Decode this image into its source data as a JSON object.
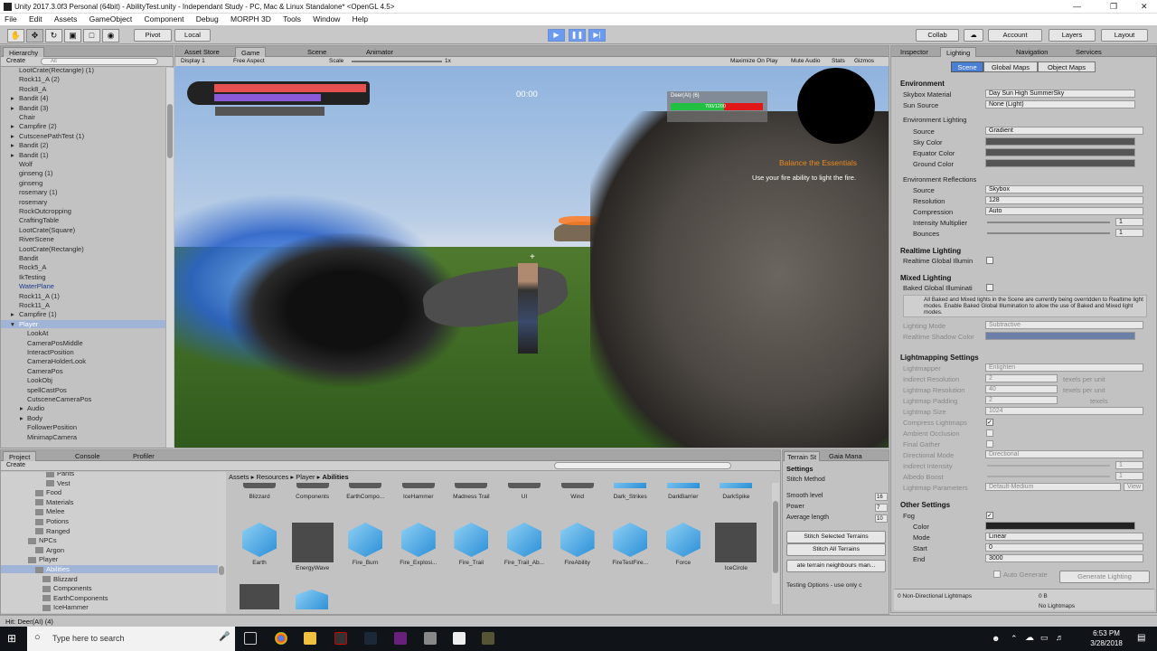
{
  "window": {
    "title": "Unity 2017.3.0f3 Personal (64bit) - AbilityTest.unity - Independant Study - PC, Mac & Linux Standalone* <OpenGL 4.5>"
  },
  "menu": [
    "File",
    "Edit",
    "Assets",
    "GameObject",
    "Component",
    "Debug",
    "MORPH 3D",
    "Tools",
    "Window",
    "Help"
  ],
  "toolbar": {
    "pivot": "Pivot",
    "local": "Local",
    "collab": "Collab",
    "account": "Account",
    "layers": "Layers",
    "layout": "Layout"
  },
  "hierarchy": {
    "tab": "Hierarchy",
    "create": "Create",
    "search_placeholder": "All",
    "items": [
      "LootCrate(Rectangle) (1)",
      "Rock11_A (2)",
      "Rock8_A",
      "Bandit (4)",
      "Bandit (3)",
      "Chair",
      "Campfire (2)",
      "CutscenePathTest (1)",
      "Bandit (2)",
      "Bandit (1)",
      "Wolf",
      "ginseng (1)",
      "ginseng",
      "rosemary (1)",
      "rosemary",
      "RockOutcropping",
      "CraftingTable",
      "LootCrate(Square)",
      "RiverScene",
      "LootCrate(Rectangle)",
      "Bandit",
      "Rock5_A",
      "IkTesting",
      "WaterPlane",
      "Rock11_A (1)",
      "Rock11_A",
      "Campfire (1)",
      "Player",
      "LookAt",
      "CameraPosMiddle",
      "InteractPosition",
      "CameraHolderLook",
      "CameraPos",
      "LookObj",
      "spellCastPos",
      "CutsceneCameraPos",
      "Audio",
      "Body",
      "FollowerPosition",
      "MinimapCamera"
    ]
  },
  "game_tabs": {
    "asset_store": "Asset Store",
    "game": "Game",
    "scene": "Scene",
    "animator": "Animator"
  },
  "game_bar": {
    "display": "Display 1",
    "aspect": "Free Aspect",
    "scale_label": "Scale",
    "scale_value": "1x",
    "maximize": "Maximize On Play",
    "mute": "Mute Audio",
    "stats": "Stats",
    "gizmos": "Gizmos"
  },
  "game_hud": {
    "timer": "00:00",
    "enemy_name": "Deer(AI) (6)",
    "enemy_hp": "700/1200",
    "enemy_hp_fraction": 0.58,
    "quest_title": "Balance the Essentials",
    "quest_text": "Use your fire ability to light the fire."
  },
  "inspector": {
    "tabs": {
      "inspector": "Inspector",
      "lighting": "Lighting",
      "navigation": "Navigation",
      "services": "Services"
    },
    "subtabs": [
      "Scene",
      "Global Maps",
      "Object Maps"
    ],
    "environment": "Environment",
    "skybox_label": "Skybox Material",
    "skybox_value": "Day Sun High SummerSky",
    "sun_label": "Sun Source",
    "sun_value": "None (Light)",
    "env_lighting": "Environment Lighting",
    "source_label": "Source",
    "source_value": "Gradient",
    "sky_color": "Sky Color",
    "equator_color": "Equator Color",
    "ground_color": "Ground Color",
    "env_reflections": "Environment Reflections",
    "refl_source_value": "Skybox",
    "resolution_label": "Resolution",
    "resolution_value": "128",
    "compression_label": "Compression",
    "compression_value": "Auto",
    "intensity_label": "Intensity Multiplier",
    "intensity_value": "1",
    "bounces_label": "Bounces",
    "bounces_value": "1",
    "realtime": "Realtime Lighting",
    "realtime_gi": "Realtime Global Illumin",
    "mixed": "Mixed Lighting",
    "baked_gi": "Baked Global Illuminati",
    "mixed_note": "All Baked and Mixed lights in the Scene are currently being overridden to Realtime light modes. Enable Baked Global Illumination to allow the use of Baked and Mixed light modes.",
    "lighting_mode_label": "Lighting Mode",
    "lighting_mode_value": "Subtractive",
    "shadow_color_label": "Realtime Shadow Color",
    "lightmap_settings": "Lightmapping Settings",
    "lightmapper_label": "Lightmapper",
    "lightmapper_value": "Enlighten",
    "indirect_res_label": "Indirect Resolution",
    "indirect_res_value": "2",
    "lightmap_res_label": "Lightmap Resolution",
    "lightmap_res_value": "40",
    "lightmap_pad_label": "Lightmap Padding",
    "lightmap_pad_value": "2",
    "texels_per_unit": "texels per unit",
    "texels": "texels",
    "lightmap_size_label": "Lightmap Size",
    "lightmap_size_value": "1024",
    "compress_label": "Compress Lightmaps",
    "ao_label": "Ambient Occlusion",
    "final_gather_label": "Final Gather",
    "dir_mode_label": "Directional Mode",
    "dir_mode_value": "Directional",
    "indirect_int_label": "Indirect Intensity",
    "indirect_int_value": "1",
    "albedo_label": "Albedo Boost",
    "albedo_value": "1",
    "lm_params_label": "Lightmap Parameters",
    "lm_params_value": "Default-Medium",
    "view": "View",
    "other": "Other Settings",
    "fog_label": "Fog",
    "color_label": "Color",
    "mode_label": "Mode",
    "mode_value": "Linear",
    "start_label": "Start",
    "start_value": "0",
    "end_label": "End",
    "end_value": "3000",
    "auto_generate": "Auto Generate",
    "generate": "Generate Lighting",
    "lightmaps_count": "0 Non-Directional Lightmaps",
    "lightmaps_size": "0 B",
    "no_lightmaps": "No Lightmaps"
  },
  "project": {
    "tabs": {
      "project": "Project",
      "console": "Console",
      "profiler": "Profiler"
    },
    "create": "Create",
    "tree": [
      "Pants",
      "Vest",
      "Food",
      "Materials",
      "Melee",
      "Potions",
      "Ranged",
      "NPCs",
      "Argon",
      "Player",
      "Abilities",
      "Blizzard",
      "Components",
      "EarthComponents",
      "IceHammer"
    ],
    "breadcrumb": [
      "Assets",
      "Resources",
      "Player",
      "Abilities"
    ],
    "row1": [
      "Blizzard",
      "Components",
      "EarthCompo...",
      "IceHammer",
      "Madness Trail",
      "UI",
      "Wind",
      "Dark_Strikes",
      "DarkBarrier",
      "DarkSpike"
    ],
    "row2": [
      "Earth",
      "EnergyWave",
      "Fire_Burn",
      "Fire_Explosi...",
      "Fire_Trail",
      "Fire_Trail_Ab...",
      "FireAbility",
      "FireTestFire...",
      "Force",
      "IceCircle"
    ]
  },
  "terrain": {
    "tabs": {
      "stitch": "Terrain St",
      "gaia": "Gaia Mana"
    },
    "settings": "Settings",
    "stitch_method": "Stitch Method",
    "smooth_label": "Smooth level",
    "smooth_value": "16",
    "power_label": "Power",
    "power_value": "7",
    "avg_label": "Average length",
    "avg_value": "10",
    "btn_selected": "Stitch Selected Terrains",
    "btn_all": "Stitch All Terrains",
    "btn_neighbours": "ate terrain neighbours man...",
    "testing": "Testing Options - use only c"
  },
  "statusbar": "Hit: Deer(AI) (4)",
  "taskbar": {
    "search": "Type here to search",
    "time": "6:53 PM",
    "date": "3/28/2018"
  }
}
